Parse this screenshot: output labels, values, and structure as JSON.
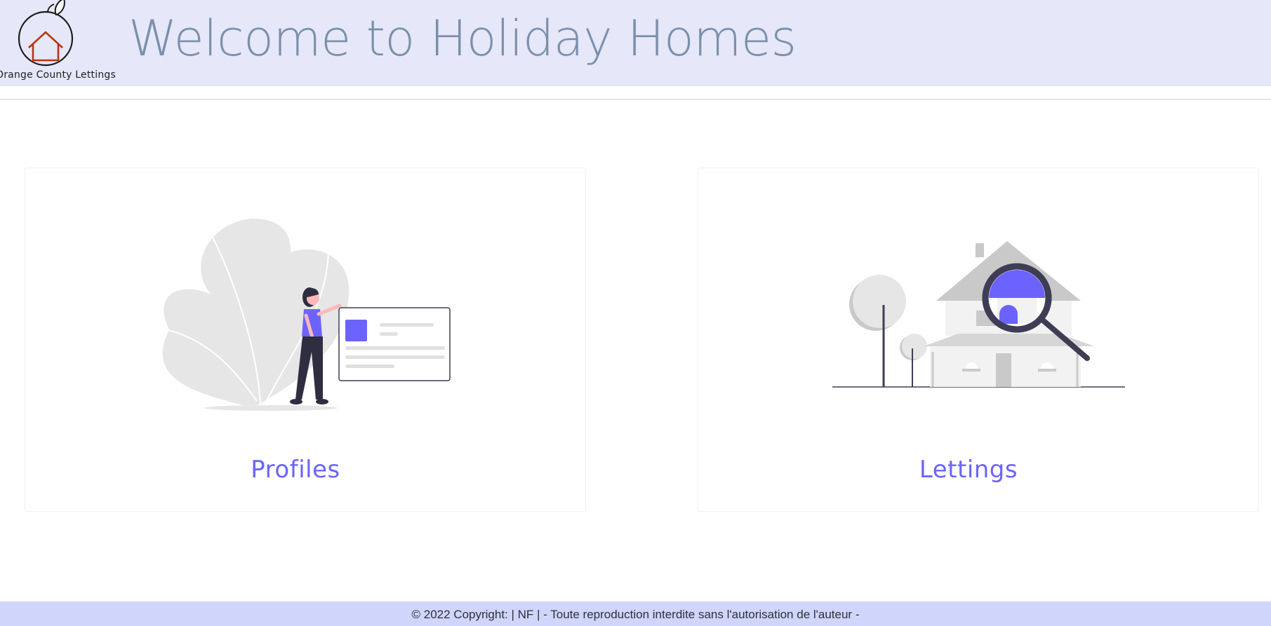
{
  "header": {
    "logo_text": "Orange County Lettings",
    "title": "Welcome to Holiday Homes"
  },
  "cards": [
    {
      "label": "Profiles",
      "illustration": "person-profile-card-illustration"
    },
    {
      "label": "Lettings",
      "illustration": "house-magnifier-illustration"
    }
  ],
  "footer": {
    "text": "© 2022 Copyright: | NF | - Toute reproduction interdite sans l'autorisation de l'auteur -"
  },
  "colors": {
    "header_bg": "#e6e7f9",
    "title": "#7a90ab",
    "accent": "#6c63ff",
    "footer_bg": "#d0d6fb",
    "logo_roof": "#b8360f"
  }
}
